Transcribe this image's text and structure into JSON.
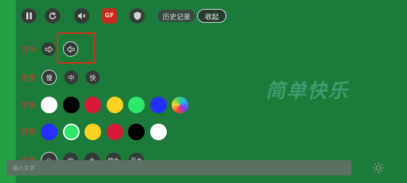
{
  "toolbar": {
    "pause_icon": "pause-icon",
    "refresh_icon": "refresh-icon",
    "mute_icon": "speaker-mute-icon",
    "gf_label": "GF",
    "shield_icon": "shield-icon",
    "history_label": "历史记录",
    "collapse_label": "收起"
  },
  "direction": {
    "label": "方向",
    "right_icon": "arrow-right-icon",
    "left_icon": "arrow-left-icon",
    "selected": "left"
  },
  "speed": {
    "label": "速度",
    "options": [
      "慢",
      "中",
      "快"
    ],
    "selected": "慢"
  },
  "text_color": {
    "label": "字色",
    "swatches": [
      "#ffffff",
      "#000000",
      "#d71a3a",
      "#ffd21f",
      "#2fe86b",
      "#2430ff",
      "rainbow"
    ]
  },
  "bg_color": {
    "label": "底色",
    "swatches": [
      "#2430ff",
      "#2fe86b",
      "#ffd21f",
      "#d71a3a",
      "#000000",
      "#ffffff"
    ],
    "selected": "#2fe86b"
  },
  "font_size": {
    "label": "字号",
    "options": [
      "小",
      "中",
      "大",
      "特大",
      "巨大"
    ],
    "selected": "小"
  },
  "watermark": "简单快乐",
  "input": {
    "placeholder": "输入文字"
  },
  "colors": {
    "background": "#1c7a3b",
    "sidebar": "#25a244",
    "accent_red": "#d43a2a",
    "highlight": "#e8281c"
  }
}
